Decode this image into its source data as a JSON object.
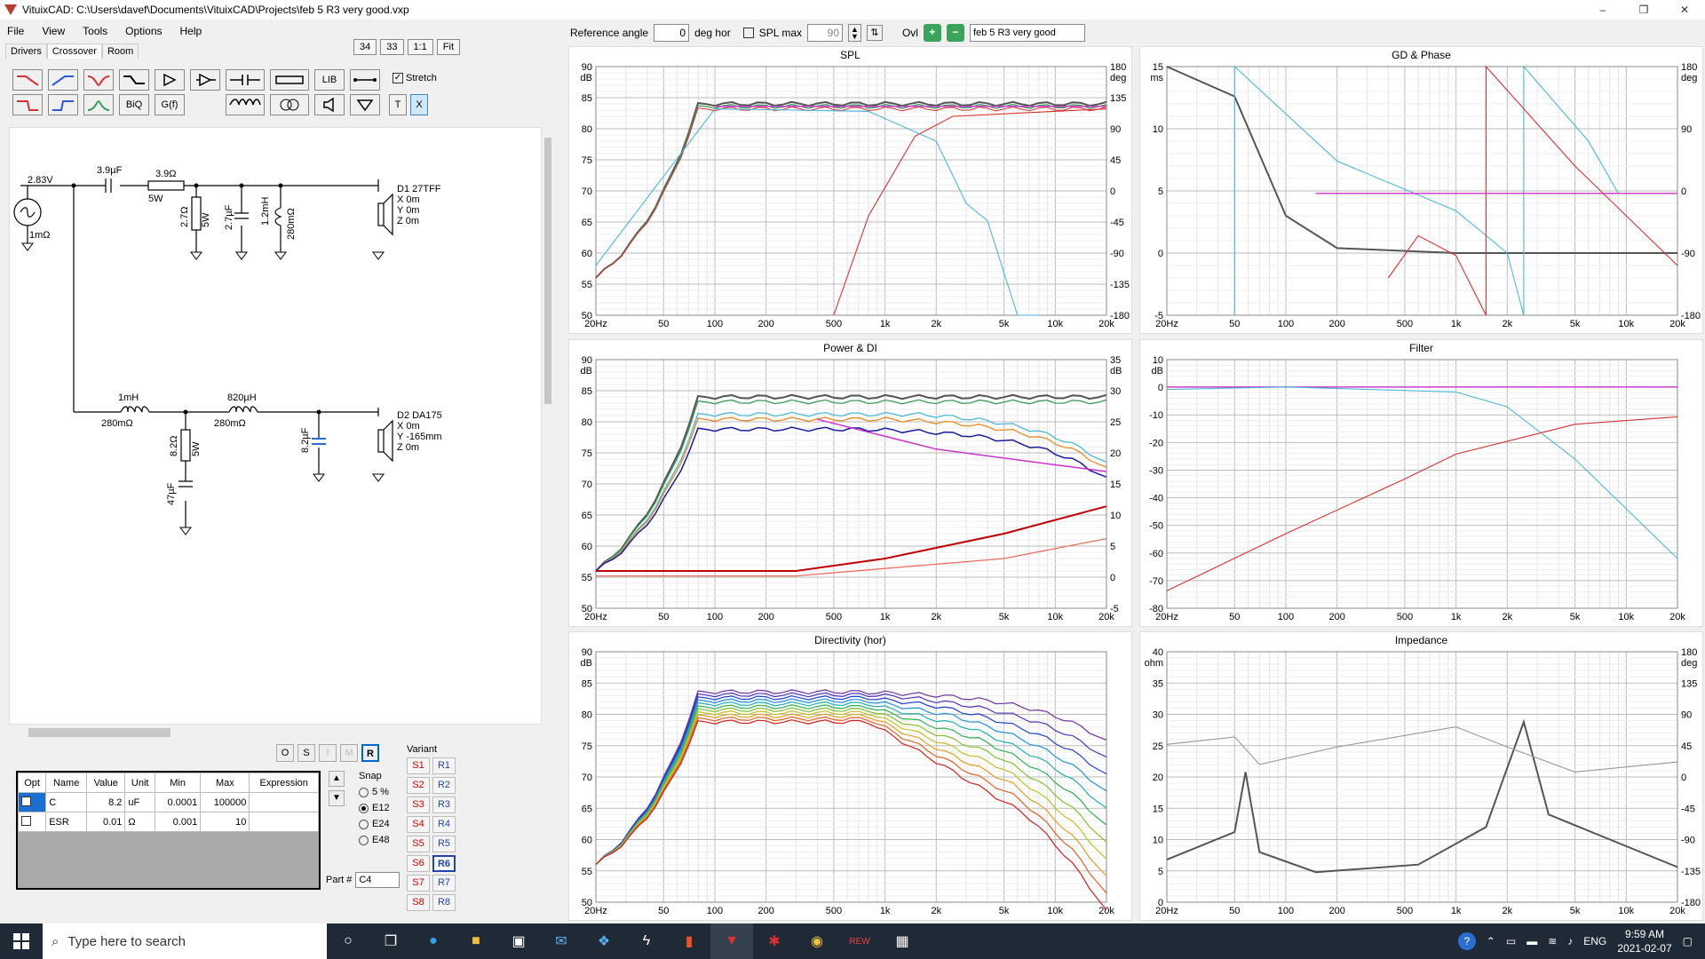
{
  "window": {
    "title": "VituixCAD: C:\\Users\\davef\\Documents\\VituixCAD\\Projects\\feb 5 R3 very good.vxp",
    "controls": [
      "–",
      "❐",
      "✕"
    ]
  },
  "menu": [
    "File",
    "View",
    "Tools",
    "Options",
    "Help"
  ],
  "tabs": [
    "Drivers",
    "Crossover",
    "Room"
  ],
  "zoom_buttons": [
    "34",
    "33",
    "1:1",
    "Fit"
  ],
  "toolbox": {
    "row1": [
      "",
      "",
      "",
      "",
      "",
      "",
      "",
      "",
      "LIB",
      "",
      "Stretch"
    ],
    "row2": [
      "",
      "",
      "",
      "BiQ",
      "G(f)",
      "",
      "",
      "",
      "",
      "T",
      "X"
    ]
  },
  "schematic": {
    "source_voltage": "2.83V",
    "source_resistance": "1mΩ",
    "c1": "3.9µF",
    "r1": "3.9Ω",
    "r1_power": "5W",
    "r2": "2.7Ω",
    "r2_power": "5W",
    "c2": "2.7µF",
    "l1": "1.2mH",
    "l1_r": "280mΩ",
    "d1": [
      "D1 27TFF",
      "X 0m",
      "Y 0m",
      "Z 0m"
    ],
    "l2": "1mH",
    "l2_r": "280mΩ",
    "l3": "820µH",
    "l3_r": "280mΩ",
    "r3": "8.2Ω",
    "r3_power": "5W",
    "c3": "47µF",
    "c4": "8.2µF",
    "d2": [
      "D2 DA175",
      "X 0m",
      "Y -165mm",
      "Z 0m"
    ]
  },
  "opt_buttons": [
    "O",
    "S",
    "I",
    "M",
    "R"
  ],
  "params": {
    "headers": [
      "Opt",
      "Name",
      "Value",
      "Unit",
      "Min",
      "Max",
      "Expression"
    ],
    "rows": [
      {
        "name": "C",
        "value": "8.2",
        "unit": "uF",
        "min": "0.0001",
        "max": "100000",
        "expr": ""
      },
      {
        "name": "ESR",
        "value": "0.01",
        "unit": "Ω",
        "min": "0.001",
        "max": "10",
        "expr": ""
      }
    ]
  },
  "snap": {
    "label": "Snap",
    "options": [
      "5 %",
      "E12",
      "E24",
      "E48"
    ],
    "selected": 1
  },
  "part": {
    "label": "Part #",
    "value": "C4"
  },
  "variant": {
    "label": "Variant",
    "s": [
      "S1",
      "S2",
      "S3",
      "S4",
      "S5",
      "S6",
      "S7",
      "S8"
    ],
    "r": [
      "R1",
      "R2",
      "R3",
      "R4",
      "R5",
      "R6",
      "R7",
      "R8"
    ],
    "active": "R6"
  },
  "reference": {
    "angle_label": "Reference angle",
    "angle_value": "0",
    "unit": "deg hor",
    "splmax_label": "SPL max",
    "splmax_value": "90",
    "ovl": "Ovl",
    "ovl_name": "feb 5 R3 very good"
  },
  "graphs": {
    "spl": {
      "title": "SPL",
      "left_unit": "dB",
      "right_unit": "deg",
      "yl": [
        "90",
        "85",
        "80",
        "75",
        "70",
        "65",
        "60",
        "55",
        "50"
      ],
      "yr": [
        "180",
        "135",
        "90",
        "45",
        "0",
        "-45",
        "-90",
        "-135",
        "-180"
      ]
    },
    "gd": {
      "title": "GD & Phase",
      "left_unit": "ms",
      "right_unit": "deg",
      "yl": [
        "15",
        "10",
        "5",
        "0",
        "-5"
      ],
      "yr": [
        "180",
        "90",
        "0",
        "-90",
        "-180"
      ]
    },
    "power": {
      "title": "Power & DI",
      "left_unit": "dB",
      "right_unit": "dB",
      "yl": [
        "90",
        "85",
        "80",
        "75",
        "70",
        "65",
        "60",
        "55",
        "50"
      ],
      "yr": [
        "35",
        "30",
        "25",
        "20",
        "15",
        "10",
        "5",
        "0",
        "-5"
      ]
    },
    "filter": {
      "title": "Filter",
      "left_unit": "dB",
      "yl": [
        "10",
        "0",
        "-10",
        "-20",
        "-30",
        "-40",
        "-50",
        "-60",
        "-70",
        "-80"
      ]
    },
    "directivity": {
      "title": "Directivity (hor)",
      "left_unit": "dB",
      "yl": [
        "90",
        "85",
        "80",
        "75",
        "70",
        "65",
        "60",
        "55",
        "50"
      ]
    },
    "impedance": {
      "title": "Impedance",
      "left_unit": "ohm",
      "right_unit": "deg",
      "yl": [
        "40",
        "35",
        "30",
        "25",
        "20",
        "15",
        "10",
        "5",
        "0"
      ],
      "yr": [
        "180",
        "135",
        "90",
        "45",
        "0",
        "-45",
        "-90",
        "-135",
        "-180"
      ]
    },
    "xticks": [
      "20Hz",
      "50",
      "100",
      "200",
      "500",
      "1k",
      "2k",
      "5k",
      "10k",
      "20k"
    ]
  },
  "colors": {
    "red": "#d93030",
    "cyan": "#4ab8d8",
    "magenta": "#cc33cc",
    "gray": "#555555",
    "green": "#3a9a5a",
    "navy": "#1a1aa0",
    "orange": "#e88a20"
  },
  "taskbar": {
    "search_placeholder": "Type here to search",
    "lang": "ENG",
    "time": "9:59 AM",
    "date": "2021-02-07"
  }
}
